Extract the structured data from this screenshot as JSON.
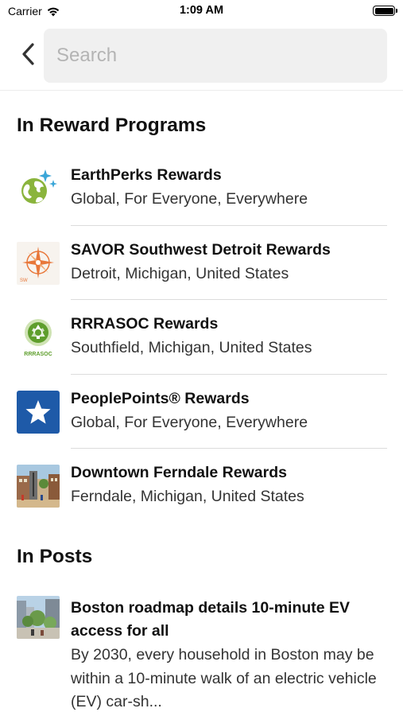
{
  "status_bar": {
    "carrier": "Carrier",
    "time": "1:09 AM"
  },
  "search": {
    "placeholder": "Search",
    "value": ""
  },
  "sections": {
    "programs_title": "In Reward Programs",
    "posts_title": "In Posts"
  },
  "programs": [
    {
      "title": "EarthPerks Rewards",
      "subtitle": "Global, For Everyone, Everywhere",
      "icon": "earth-sparkle-icon"
    },
    {
      "title": "SAVOR Southwest Detroit Rewards",
      "subtitle": "Detroit, Michigan, United States",
      "icon": "compass-star-logo",
      "logo_text": "SW"
    },
    {
      "title": "RRRASOC Rewards",
      "subtitle": "Southfield, Michigan, United States",
      "icon": "recycle-logo",
      "logo_text": "RRRASOC"
    },
    {
      "title": "PeoplePoints® Rewards",
      "subtitle": "Global, For Everyone, Everywhere",
      "icon": "star-badge-icon"
    },
    {
      "title": "Downtown Ferndale Rewards",
      "subtitle": "Ferndale, Michigan, United States",
      "icon": "downtown-photo"
    }
  ],
  "posts": [
    {
      "title": "Boston roadmap details 10-minute EV access for all",
      "body": "By 2030, every household in Boston may be within a 10-minute walk of an electric vehicle (EV) car-sh...",
      "icon": "city-photo"
    }
  ],
  "colors": {
    "earth_green": "#8ab43c",
    "sparkle_blue": "#3aa6d8",
    "savor_orange": "#e8773a",
    "recycle_green": "#5e9e2c",
    "peoplepoints_blue": "#1e5aa8",
    "divider": "#dcdcdc"
  }
}
